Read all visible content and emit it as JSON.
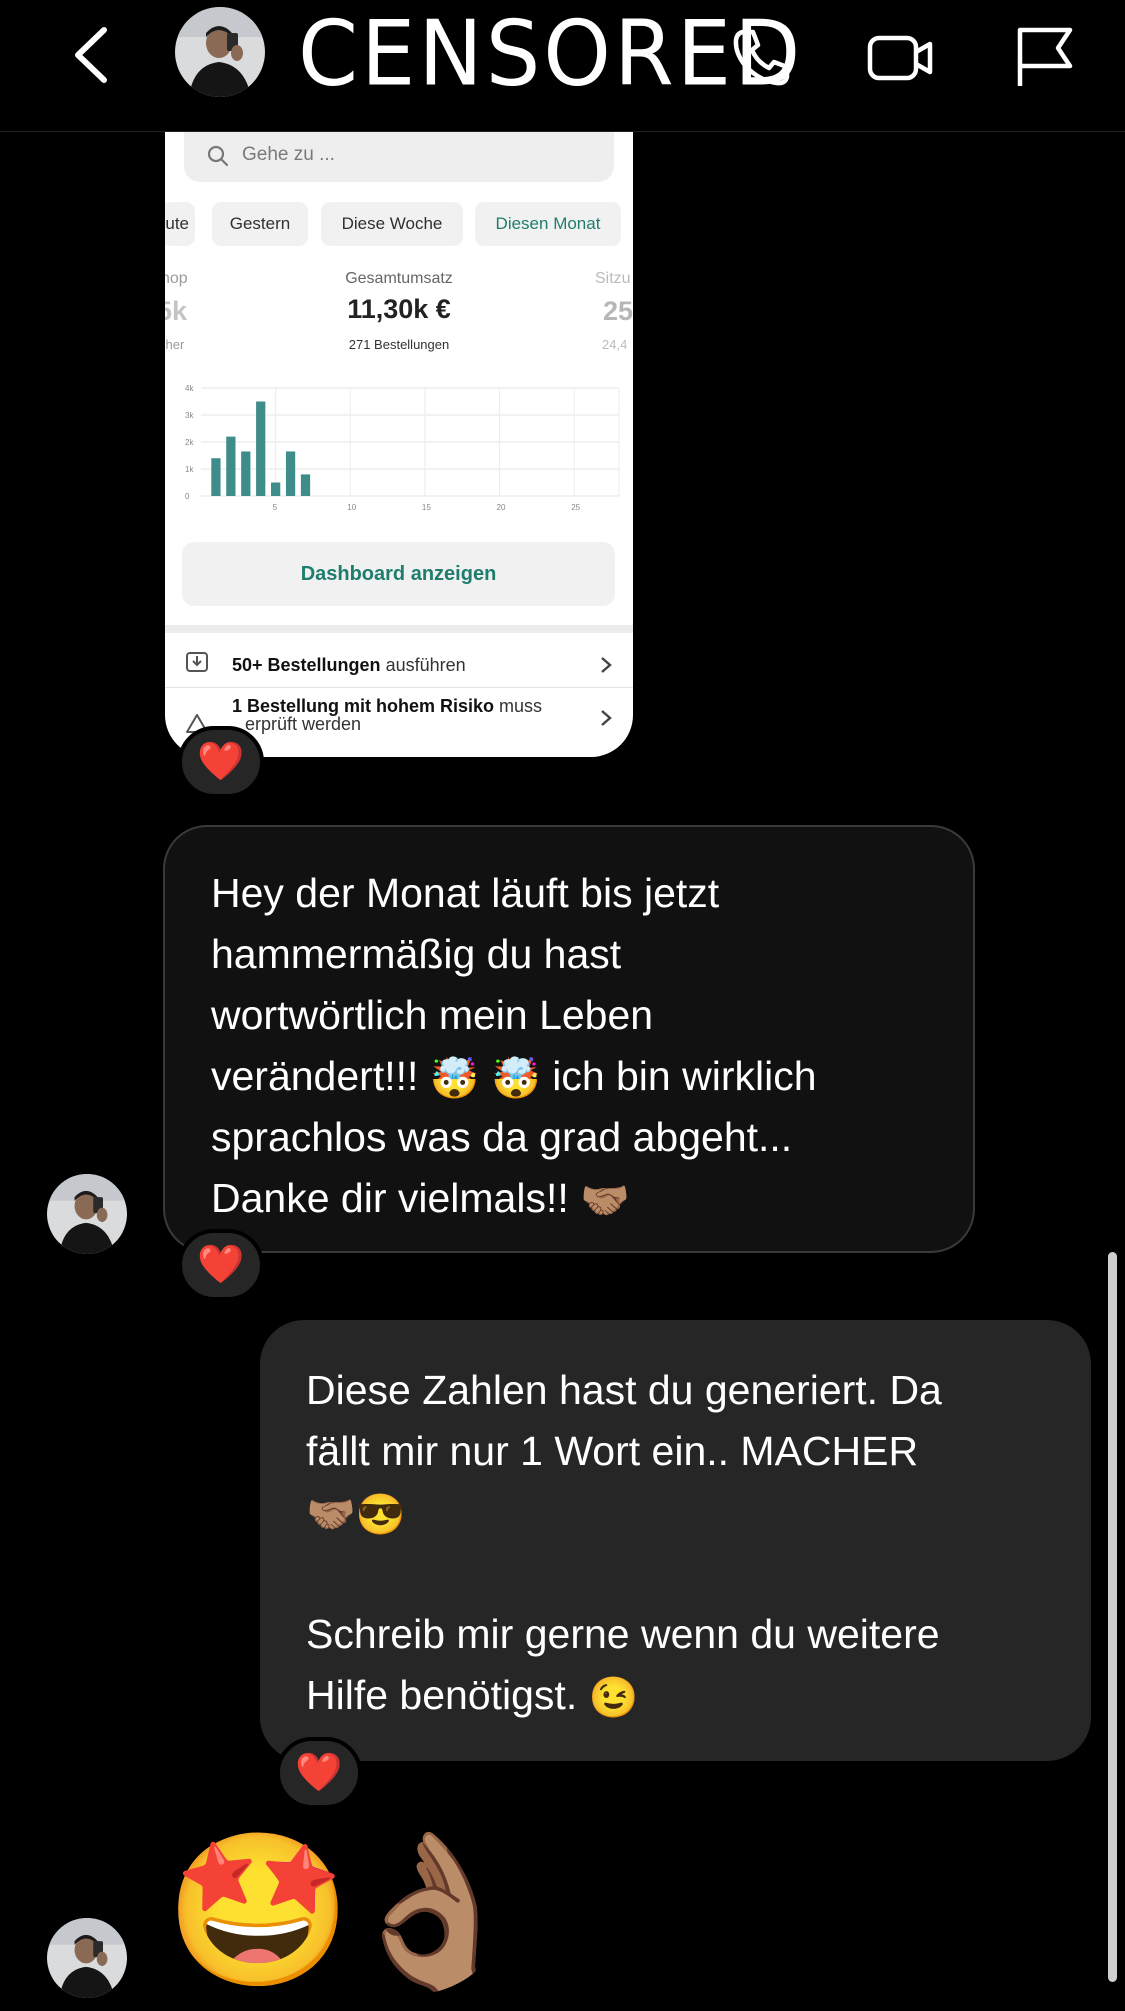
{
  "header": {
    "contact_name": "CENSORED",
    "icons": [
      "back-icon",
      "avatar",
      "phone-icon",
      "video-icon",
      "flag-icon"
    ]
  },
  "screenshot": {
    "search_placeholder": "Gehe zu ...",
    "chips": {
      "partial": "ute",
      "yesterday": "Gestern",
      "this_week": "Diese Woche",
      "this_month": "Diesen Monat"
    },
    "metric_left": {
      "label": "hop",
      "value": "5k",
      "sub": "cher"
    },
    "metric_main": {
      "label": "Gesamtumsatz",
      "value": "11,30k €",
      "sub": "271 Bestellungen"
    },
    "metric_right": {
      "label": "Sitzu",
      "value": "25",
      "sub": "24,4"
    },
    "dashboard_button": "Dashboard anzeigen",
    "tasks": [
      {
        "bold": "50+ Bestellungen",
        "rest": " ausführen"
      },
      {
        "bold": "1 Bestellung mit hohem Risiko",
        "rest": " muss",
        "line2": "erprüft werden"
      }
    ],
    "accent_color": "#1f7d6d"
  },
  "chart_data": {
    "type": "bar",
    "y_ticks": [
      "0",
      "1k",
      "2k",
      "3k",
      "4k"
    ],
    "x_ticks": [
      "5",
      "10",
      "15",
      "20",
      "25"
    ],
    "ylim": [
      0,
      4000
    ],
    "xlim": [
      0,
      28
    ],
    "x": [
      1,
      2,
      3,
      4,
      5,
      6,
      7
    ],
    "values": [
      1400,
      2200,
      1650,
      3500,
      500,
      1650,
      800
    ],
    "bar_color": "#3f8d8b",
    "grid": true
  },
  "messages": {
    "incoming": {
      "lines": [
        "Hey der Monat läuft bis jetzt",
        "hammermäßig du hast",
        "wortwörtlich mein Leben",
        "verändert!!! ",
        " ich bin wirklich",
        "sprachlos was da grad abgeht...",
        "Danke dir vielmals!! "
      ],
      "emoji_exploding": "🤯",
      "emoji_handshake": "🤝🏽"
    },
    "outgoing": {
      "lines": [
        "Diese Zahlen hast du generiert. Da",
        "fällt mir nur 1 Wort ein.. MACHER",
        "",
        "Schreib mir gerne wenn du weitere",
        "Hilfe benötigst. "
      ],
      "emoji_line": "🤝🏽😎",
      "emoji_wink": "😉"
    },
    "reaction": "❤️",
    "big_emojis": [
      "🤩",
      "👌🏽"
    ]
  }
}
